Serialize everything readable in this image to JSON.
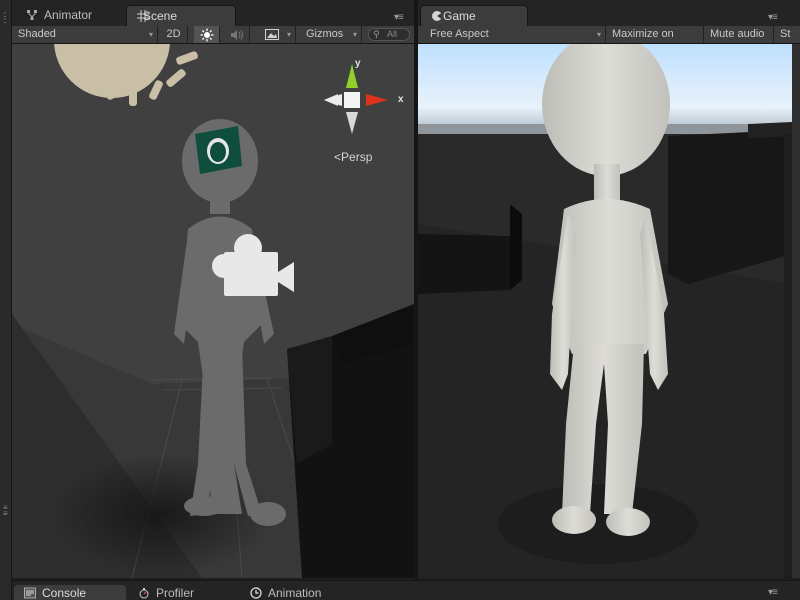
{
  "panels": {
    "left_tabs": [
      {
        "label": "Animator",
        "icon": "animator-icon"
      },
      {
        "label": "Scene",
        "icon": "scene-grid-icon"
      }
    ],
    "right_tabs": [
      {
        "label": "Game",
        "icon": "game-controller-icon"
      }
    ],
    "menu_glyph": "▾≡"
  },
  "scene_toolbar": {
    "draw_mode": "Shaded",
    "mode_2d": "2D",
    "lighting_icon": "sun-icon",
    "audio_icon": "speaker-icon",
    "effects_icon": "image-icon",
    "gizmos": "Gizmos",
    "search_placeholder": "All"
  },
  "game_toolbar": {
    "aspect": "Free Aspect",
    "maximize": "Maximize on Play",
    "mute": "Mute audio",
    "stats": "St"
  },
  "scene_gizmo": {
    "projection": "Persp",
    "x_label": "x",
    "y_label": "y",
    "colors": {
      "x": "#e0331c",
      "y": "#8fd12a",
      "z": "#d8d8d8"
    }
  },
  "bottom_tabs": [
    {
      "label": "Console",
      "icon": "console-icon"
    },
    {
      "label": "Profiler",
      "icon": "profiler-icon"
    },
    {
      "label": "Animation",
      "icon": "clock-icon"
    }
  ],
  "colors": {
    "panel_bg": "#3c3c3c",
    "tabbar_bg": "#242424",
    "scene_bg": "#404040",
    "sky_top": "#bfe0ff"
  }
}
